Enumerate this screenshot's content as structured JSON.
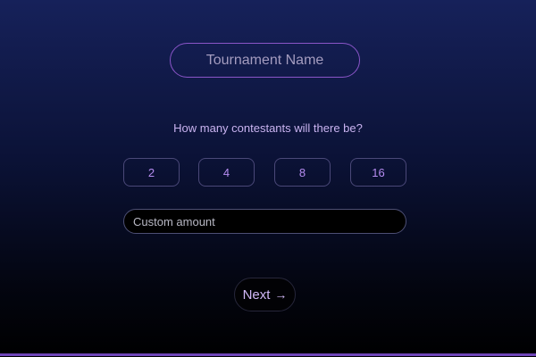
{
  "form": {
    "tournament_name": {
      "value": "",
      "placeholder": "Tournament Name"
    },
    "question": "How many contestants will there be?",
    "contestant_options": [
      "2",
      "4",
      "8",
      "16"
    ],
    "custom_amount": {
      "value": "",
      "placeholder": "Custom amount"
    },
    "next_button": {
      "label": "Next",
      "icon": "arrow-right-icon",
      "icon_glyph": "→"
    }
  },
  "colors": {
    "accent": "#8a55c8",
    "option_text": "#b58cf0",
    "background_top": "#16215a",
    "background_bottom": "#000000"
  }
}
